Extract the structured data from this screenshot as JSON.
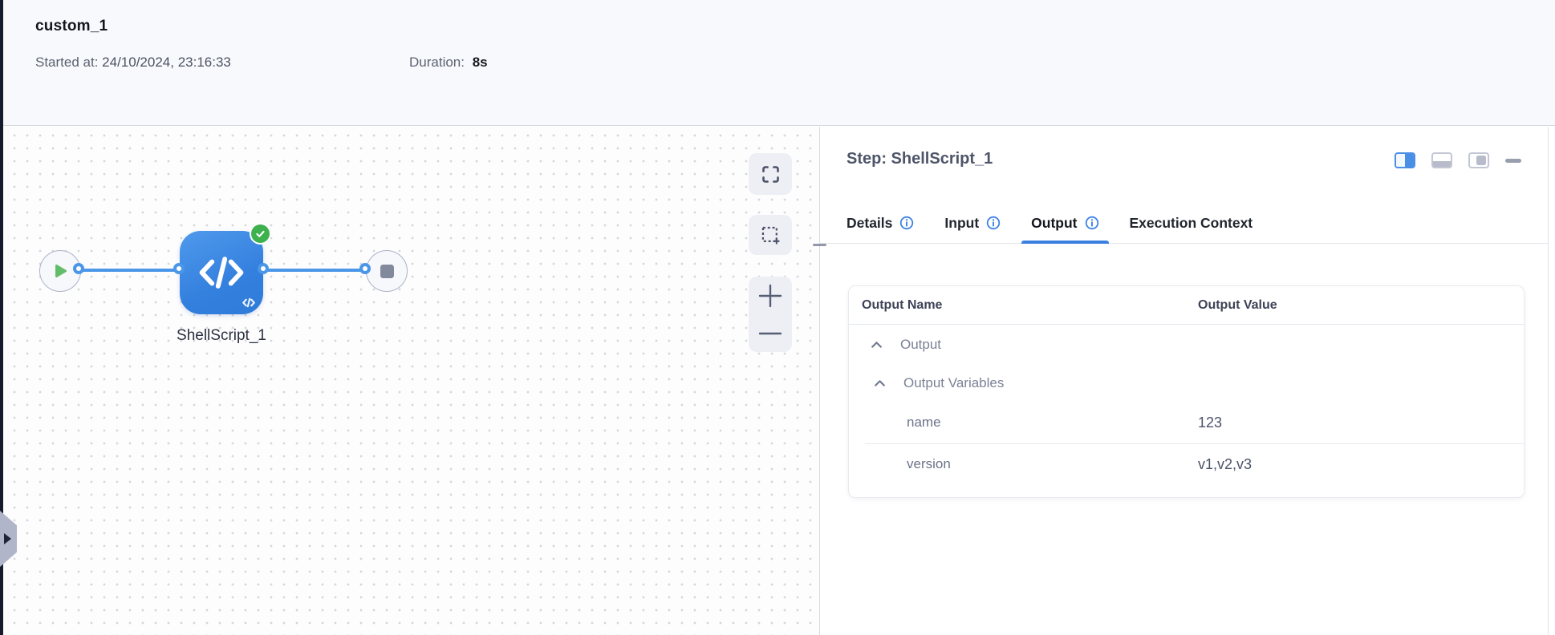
{
  "header": {
    "title": "custom_1",
    "started_label": "Started at:",
    "started_value": "24/10/2024, 23:16:33",
    "duration_label": "Duration:",
    "duration_value": "8s"
  },
  "canvas": {
    "node_label": "ShellScript_1",
    "node_status": "success",
    "icons": [
      "play-icon",
      "code-icon",
      "check-icon",
      "stop-icon",
      "fullscreen-icon",
      "marquee-select-icon",
      "zoom-in-icon",
      "zoom-out-icon",
      "expand-sidebar-icon"
    ]
  },
  "panel": {
    "title": "Step: ShellScript_1",
    "layout_icons": [
      "split-vertical-icon",
      "split-horizontal-icon",
      "panel-right-icon",
      "collapse-icon"
    ],
    "tabs": [
      {
        "label": "Details",
        "has_info": true,
        "active": false
      },
      {
        "label": "Input",
        "has_info": true,
        "active": false
      },
      {
        "label": "Output",
        "has_info": true,
        "active": true
      },
      {
        "label": "Execution Context",
        "has_info": false,
        "active": false
      }
    ],
    "table": {
      "columns": [
        "Output Name",
        "Output Value"
      ],
      "groups": [
        {
          "label": "Output",
          "expanded": true
        },
        {
          "label": "Output Variables",
          "expanded": true
        }
      ],
      "rows": [
        {
          "name": "name",
          "value": "123"
        },
        {
          "name": "version",
          "value": "v1,v2,v3"
        }
      ]
    }
  },
  "colors": {
    "accent_blue": "#4a96e8",
    "active_tab_underline": "#3b7fe0",
    "success_green": "#3cb14d",
    "node_blue": "#3480de",
    "header_bg": "#f8f9fc",
    "dark_strip": "#171b2e"
  }
}
